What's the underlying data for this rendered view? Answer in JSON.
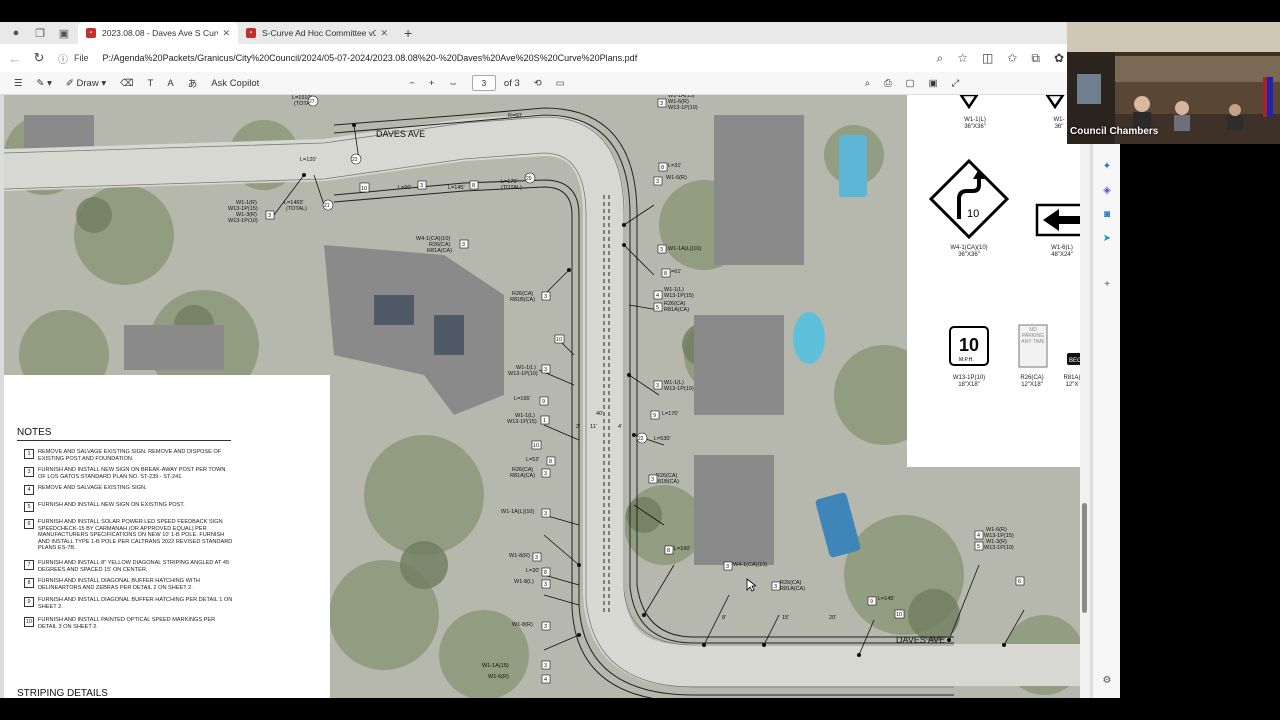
{
  "tabs": [
    {
      "title": "2023.08.08 - Daves Ave S Curve",
      "active": true
    },
    {
      "title": "S-Curve Ad Hoc Committee v06",
      "active": false
    }
  ],
  "address": {
    "scheme_label": "File",
    "url": "P:/Agenda%20Packets/Granicus/City%20Council/2024/05-07-2024/2023.08.08%20-%20Daves%20Ave%20S%20Curve%20Plans.pdf"
  },
  "pdf_toolbar": {
    "draw_label": "Draw",
    "copilot_label": "Ask Copilot",
    "page_current": "3",
    "page_total": "of 3"
  },
  "map": {
    "street_top": "DAVES AVE",
    "street_bottom": "DAVES AVE",
    "labels": [
      "L=1510'",
      "(TOTAL)",
      "R=60'",
      "L=120'",
      "L=90'",
      "L=145'",
      "L=170'",
      "(TOTAL)",
      "L=1465'",
      "(TOTAL)",
      "W1-1(R)",
      "W13-1P(15)",
      "W1-3(R)",
      "W13-1P(10)",
      "W4-1(CA)(10)",
      "R26(CA)",
      "R81A(CA)",
      "R26(CA)",
      "R81B(CA)",
      "W1-1A(15)",
      "W1-6(R)",
      "W13-1P(10)",
      "L=31'",
      "W1-6(R)",
      "W1-1A(L)(10)",
      "L=61'",
      "W1-1(L)",
      "W13-1P(15)",
      "R26(CA)",
      "R81A(CA)",
      "W1-1(L)",
      "W13-1P(10)",
      "L=165'",
      "W1-1(L)",
      "W13-1P(15)",
      "L=170'",
      "L=530'",
      "L=52'",
      "R26(CA)",
      "R81A(CA)",
      "W1-1A(L)(10)",
      "R26(CA)",
      "R81B(CA)",
      "W1-8(R)",
      "L=160'",
      "W4-1(CA)(10)",
      "L=30'",
      "W1-8(L)",
      "R26(CA)",
      "R81A(CA)",
      "L=145'",
      "W1-8(R)",
      "W1-1A(15)",
      "W1-6(R)",
      "W1-6(R)",
      "W13-1P(15)",
      "W13-1P(10)",
      "40'",
      "20'",
      "15'",
      "8'",
      "11'",
      "4'",
      "2'"
    ]
  },
  "signs": [
    {
      "code": "W1-1(L)",
      "size": "36\"X36\""
    },
    {
      "code": "W1-",
      "size": "36\""
    },
    {
      "code": "W4-1(CA)(10)",
      "size": "36\"X36\"",
      "value": "10"
    },
    {
      "code": "W1-6(L)",
      "size": "48\"X24\""
    },
    {
      "code": "W13-1P(10)",
      "size": "18\"X18\"",
      "value": "10",
      "unit": "M.P.H."
    },
    {
      "code": "R26(CA)",
      "size": "12\"X18\"",
      "text": "NO PARKING ANY TIME"
    },
    {
      "code": "R81A(",
      "size": "12\"X"
    }
  ],
  "notes": {
    "title": "NOTES",
    "items": [
      {
        "num": "1",
        "text": "REMOVE AND SALVAGE EXISTING SIGN. REMOVE AND DISPOSE OF EXISTING POST AND FOUNDATION."
      },
      {
        "num": "3",
        "text": "FURNISH AND INSTALL NEW SIGN ON BREAK-AWAY POST PER TOWN OF LOS GATOS STANDARD PLAN NO. ST-239 - ST-241."
      },
      {
        "num": "4",
        "text": "REMOVE AND SALVAGE EXISTING SIGN."
      },
      {
        "num": "5",
        "text": "FURNISH AND INSTALL NEW SIGN ON EXISTING POST."
      },
      {
        "num": "6",
        "text": "FURNISH AND INSTALL SOLAR POWER LED SPEED FEEDBACK SIGN SPEEDCHECK-15 BY CARMANAH (OR APPROVED EQUAL) PER MANUFACTURERS SPECIFICATIONS ON NEW 10' 1-B POLE. FURNISH AND INSTALL TYPE 1-B POLE PER CALTRANS 2022 REVISED STANDARD PLANS ES-7B."
      },
      {
        "num": "7",
        "text": "FURNISH AND INSTALL 8\" YELLOW DIAGONAL STRIPING ANGLED AT 45 DEGREES AND SPACED 15' ON CENTER."
      },
      {
        "num": "8",
        "text": "FURNISH AND INSTALL DIAGONAL BUFFER HATCHING WITH DELINEARTORS AND ZEBRAS PER DETAIL 2 ON SHEET 2."
      },
      {
        "num": "9",
        "text": "FURNISH AND INSTALL DIAGONAL BUFFER HATCHING PER DETAIL 1 ON SHEET 2."
      },
      {
        "num": "10",
        "text": "FURNISH AND INSTALL PAINTED OPTICAL SPEED MARKINGS PER DETAIL 3 ON SHEET 2."
      }
    ],
    "striping_title": "STRIPING DETAILS"
  },
  "video": {
    "label": "Council Chambers"
  }
}
